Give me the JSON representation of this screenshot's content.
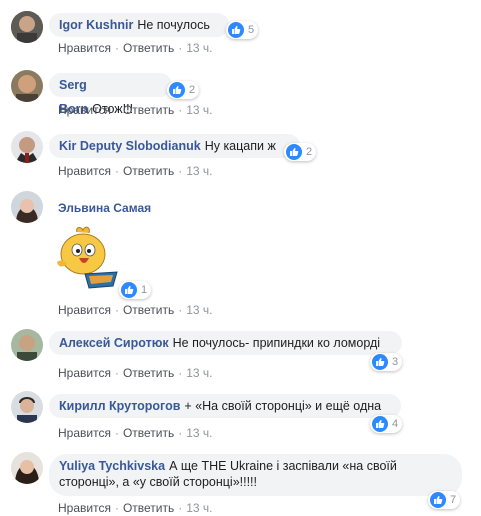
{
  "actions": {
    "like": "Нравится",
    "reply": "Ответить",
    "sep": "·",
    "time": "13 ч."
  },
  "comments": [
    {
      "author": "Igor Kushnir",
      "text": "Не почулось",
      "likes": "5"
    },
    {
      "author": "Serg Born",
      "text": "Отож!!!",
      "likes": "2"
    },
    {
      "author": "Kir Deputy Slobodianuk",
      "text": "Ну кацапи ж",
      "likes": "2"
    },
    {
      "author": "Эльвина Самая",
      "text": "",
      "likes": "1"
    },
    {
      "author": "Алексей Сиротюк",
      "text": "Не почулось- припиндки ко ломорді",
      "likes": "3"
    },
    {
      "author": "Кирилл Круторогов",
      "text": "+ «На своїй сторонці» и ещё одна",
      "likes": "4"
    },
    {
      "author": "Yuliya Tychkivska",
      "text": "А ще THE Ukraine і заспівали «на своїй сторонці», а «у своїй сторонці»!!!!!",
      "likes": "7"
    }
  ],
  "colors": {
    "link": "#385898",
    "like": "#2e89ff",
    "bubble": "#f2f3f5"
  }
}
